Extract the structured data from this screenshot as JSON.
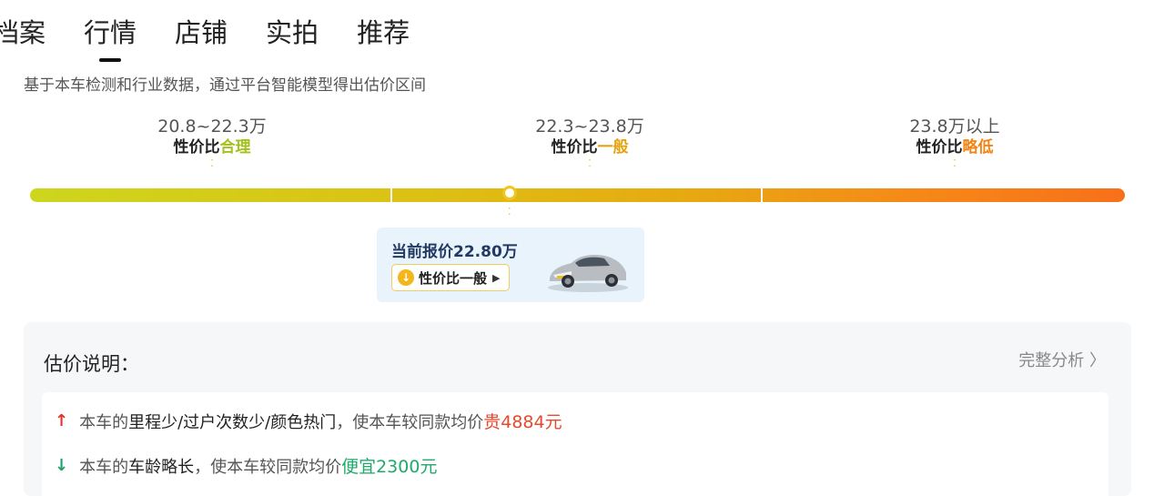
{
  "tabs": [
    "档案",
    "行情",
    "店铺",
    "实拍",
    "推荐"
  ],
  "description": "基于本车检测和行业数据，通过平台智能模型得出估价区间",
  "ranges": [
    {
      "price": "20.8~22.3万",
      "prefix": "性价比",
      "level": "合理"
    },
    {
      "price": "22.3~23.8万",
      "prefix": "性价比",
      "level": "一般"
    },
    {
      "price": "23.8万以上",
      "prefix": "性价比",
      "level": "略低"
    }
  ],
  "current": {
    "label": "当前报价22.80万",
    "badge": "性价比一般",
    "price_value": 22.8
  },
  "panel": {
    "title": "估价说明：",
    "more": "完整分析",
    "line1": {
      "pre": "本车的",
      "em": "里程少/过户次数少/颜色热门",
      "mid": "，使本车较同款均价",
      "value": "贵4884元"
    },
    "line2": {
      "pre": "本车的",
      "em": "车龄略长",
      "mid": "，使本车较同款均价",
      "value": "便宜2300元"
    }
  },
  "colors": {
    "reasonable": "#a2c21a",
    "average": "#e3a410",
    "low": "#f38413",
    "up": "#e5332a",
    "down": "#22a06b"
  },
  "icons": [
    "up-arrow-icon",
    "down-arrow-icon",
    "down-circle-icon",
    "play-triangle-icon",
    "chevron-right-icon",
    "car-image"
  ]
}
